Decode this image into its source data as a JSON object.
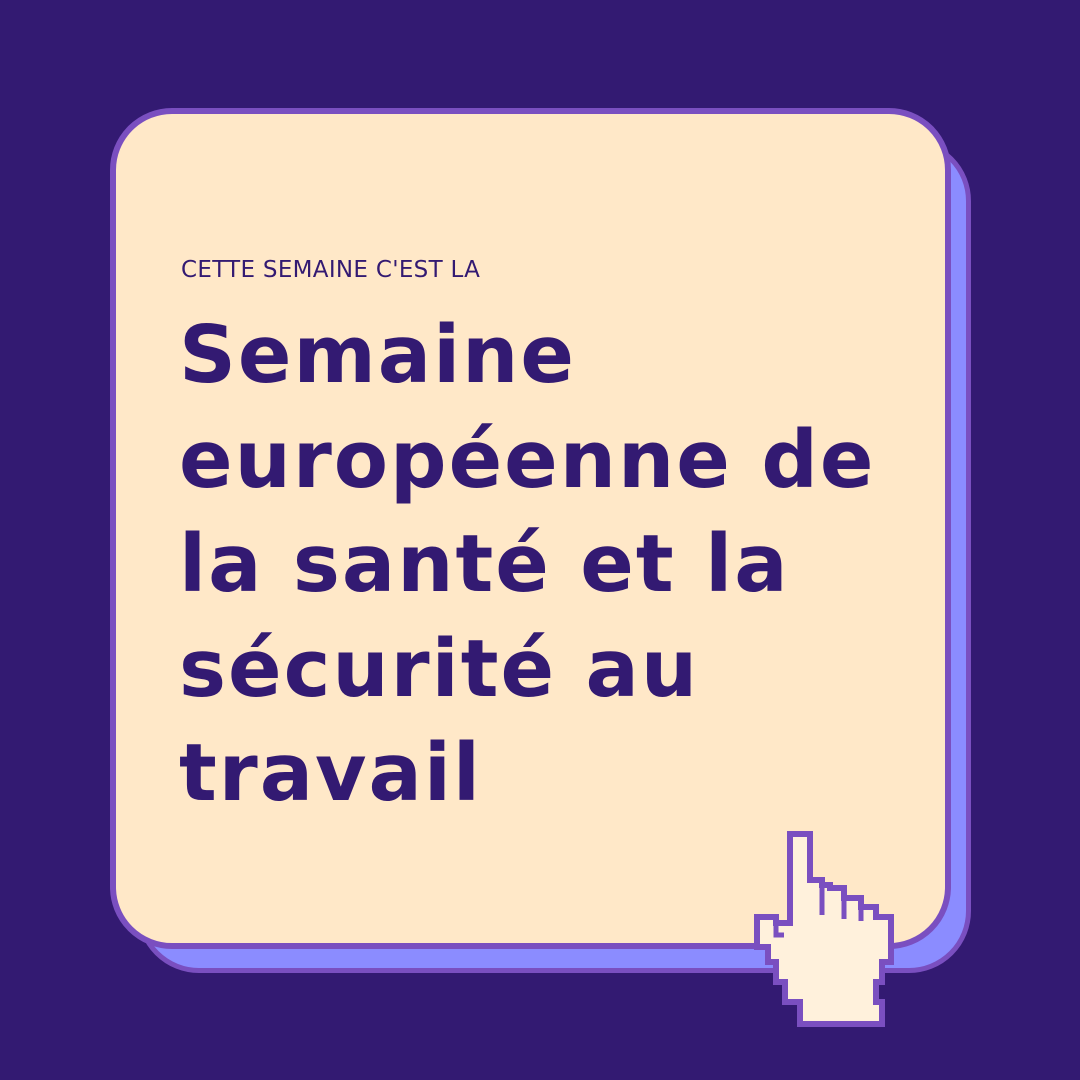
{
  "colors": {
    "background": "#331a72",
    "card_fill": "#ffe8c8",
    "card_border": "#7a4fc0",
    "card_shadow": "#8b8cff",
    "text": "#331a72",
    "cursor_fill": "#fff1dc",
    "cursor_outline": "#7a4fc0"
  },
  "eyebrow": "CETTE SEMAINE C'EST LA",
  "headline": {
    "lines": [
      "Semaine",
      "européenne de",
      "la santé et la",
      "sécurité au",
      "travail"
    ]
  },
  "icons": {
    "cursor": "pointing-hand-cursor-icon"
  }
}
